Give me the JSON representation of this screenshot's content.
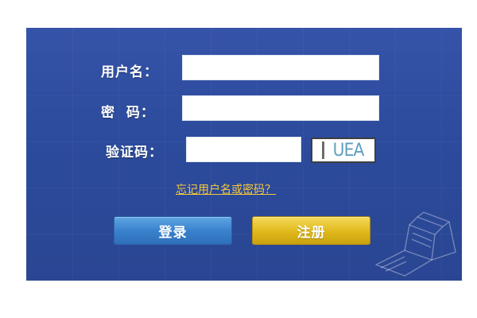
{
  "form": {
    "username_label": "用户名：",
    "password_label": "密  码：",
    "captcha_label": "验证码：",
    "username_value": "",
    "password_value": "",
    "captcha_value": "",
    "captcha_image_text": "UEA",
    "forgot_link": "忘记用户名或密码？",
    "login_button": "登录",
    "register_button": "注册"
  },
  "colors": {
    "panel_background": "#2e4c9c",
    "link": "#f6c83a",
    "login_button": "#3a82cd",
    "register_button": "#e0b81a"
  },
  "icons": {
    "decoration": "open-book-icon"
  }
}
